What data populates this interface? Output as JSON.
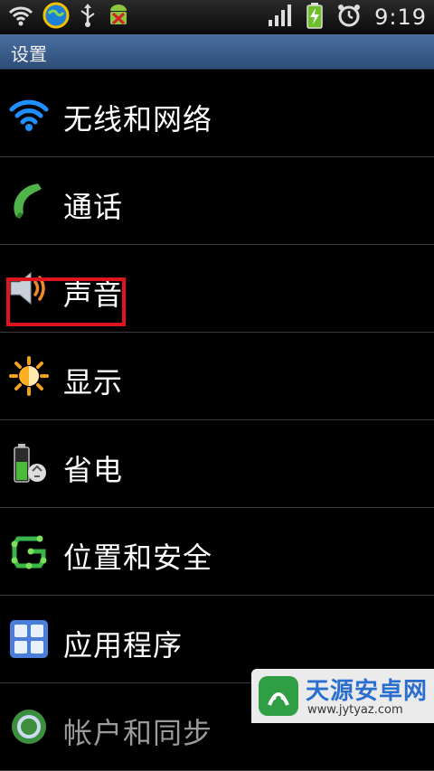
{
  "status_bar": {
    "time": "9:19",
    "left_icons": [
      "wifi-icon",
      "browser-globe-icon",
      "usb-icon",
      "android-debug-icon"
    ],
    "right_icons": [
      "signal-icon",
      "battery-charging-icon",
      "alarm-icon"
    ]
  },
  "title_bar": {
    "title": "设置"
  },
  "settings": {
    "items": [
      {
        "label": "无线和网络",
        "icon": "wifi-icon"
      },
      {
        "label": "通话",
        "icon": "phone-icon"
      },
      {
        "label": "声音",
        "icon": "speaker-icon"
      },
      {
        "label": "显示",
        "icon": "brightness-icon"
      },
      {
        "label": "省电",
        "icon": "battery-recycle-icon"
      },
      {
        "label": "位置和安全",
        "icon": "location-security-icon"
      },
      {
        "label": "应用程序",
        "icon": "apps-grid-icon"
      },
      {
        "label": "帐户和同步",
        "icon": "sync-icon"
      }
    ]
  },
  "watermark": {
    "main": "天源安卓网",
    "sub": "www.jytyaz.com"
  },
  "colors": {
    "highlight": "#e0141c",
    "title_bar": "#3c5f8e",
    "divider": "#3a3a3a"
  }
}
